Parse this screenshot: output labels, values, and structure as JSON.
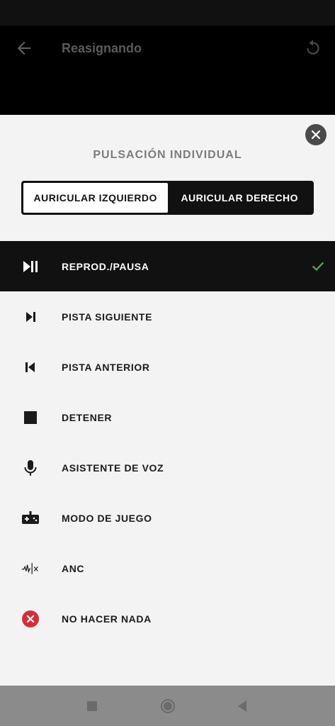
{
  "app_bar": {
    "title": "Reasignando"
  },
  "sheet": {
    "title": "PULSACIÓN INDIVIDUAL",
    "toggle": {
      "left_label": "AURICULAR IZQUIERDO",
      "right_label": "AURICULAR DERECHO",
      "selected": "left"
    },
    "items": [
      {
        "label": "REPROD./PAUSA",
        "icon": "play-pause-icon",
        "selected": true
      },
      {
        "label": "PISTA SIGUIENTE",
        "icon": "skip-next-icon",
        "selected": false
      },
      {
        "label": "PISTA ANTERIOR",
        "icon": "skip-previous-icon",
        "selected": false
      },
      {
        "label": "DETENER",
        "icon": "stop-icon",
        "selected": false
      },
      {
        "label": "ASISTENTE DE VOZ",
        "icon": "microphone-icon",
        "selected": false
      },
      {
        "label": "MODO DE JUEGO",
        "icon": "gamepad-icon",
        "selected": false
      },
      {
        "label": "ANC",
        "icon": "anc-waveform-icon",
        "selected": false
      },
      {
        "label": "NO HACER NADA",
        "icon": "do-nothing-icon",
        "selected": false
      }
    ]
  },
  "colors": {
    "selected_row": "#111111",
    "check": "#4caf50",
    "do_nothing": "#d32f3a",
    "sheet_bg": "#f3f3f3"
  }
}
